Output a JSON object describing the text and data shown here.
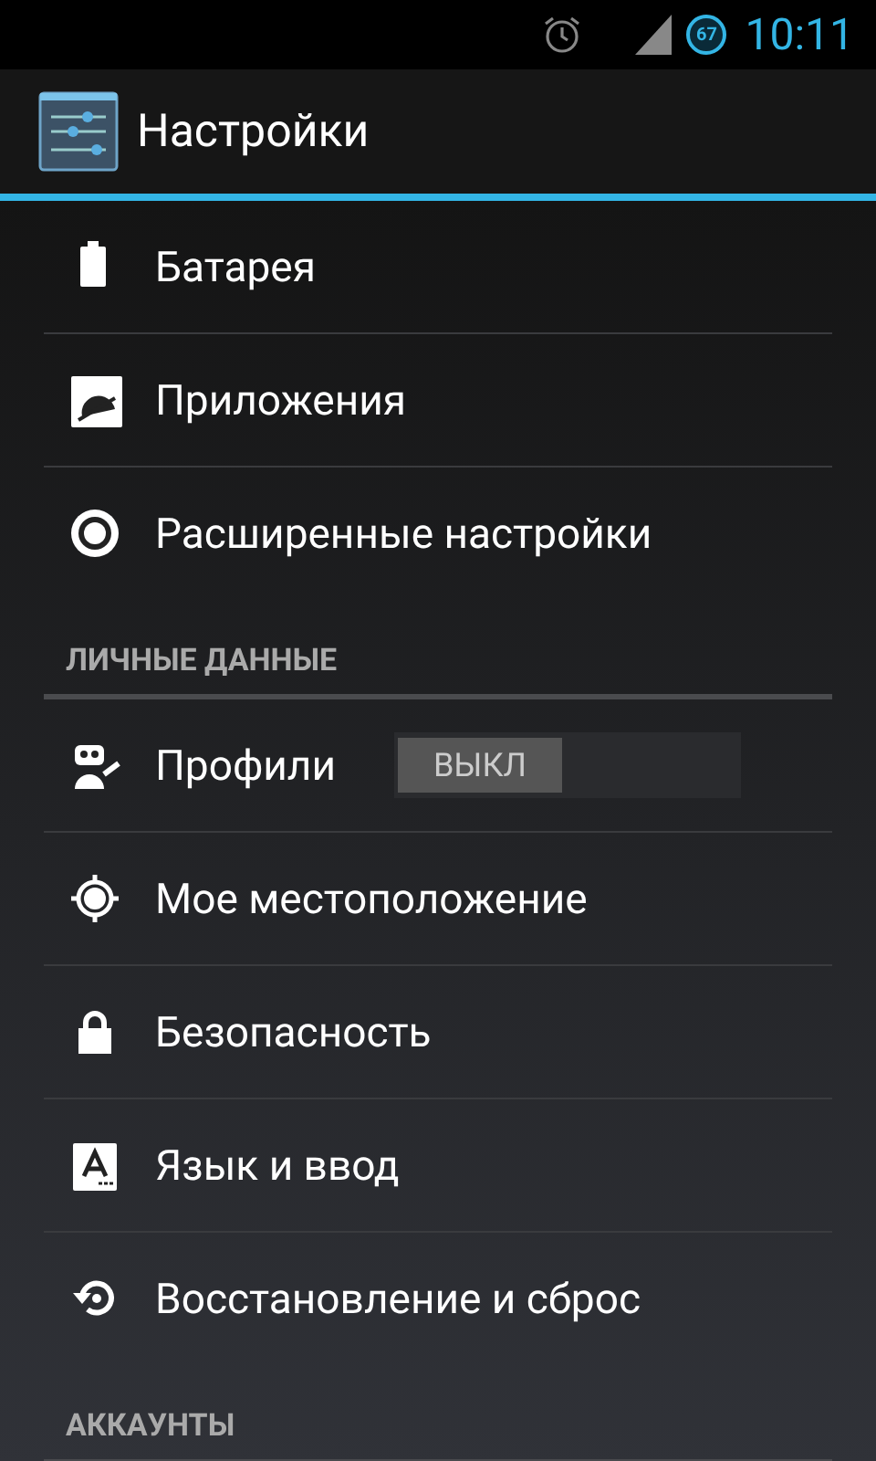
{
  "status_bar": {
    "battery": "67",
    "time": "10:11"
  },
  "action_bar": {
    "title": "Настройки"
  },
  "list": [
    {
      "kind": "item",
      "label": "Батарея"
    },
    {
      "kind": "item",
      "label": "Приложения"
    },
    {
      "kind": "item",
      "label": "Расширенные настройки"
    },
    {
      "kind": "section",
      "label": "ЛИЧНЫЕ ДАННЫЕ"
    },
    {
      "kind": "toggle",
      "label": "Профили",
      "switch_label": "ВЫКЛ",
      "on": false
    },
    {
      "kind": "item",
      "label": "Мое местоположение"
    },
    {
      "kind": "item",
      "label": "Безопасность"
    },
    {
      "kind": "item",
      "label": "Язык и ввод"
    },
    {
      "kind": "item",
      "label": "Восстановление и сброс"
    },
    {
      "kind": "section",
      "label": "АККАУНТЫ"
    }
  ]
}
